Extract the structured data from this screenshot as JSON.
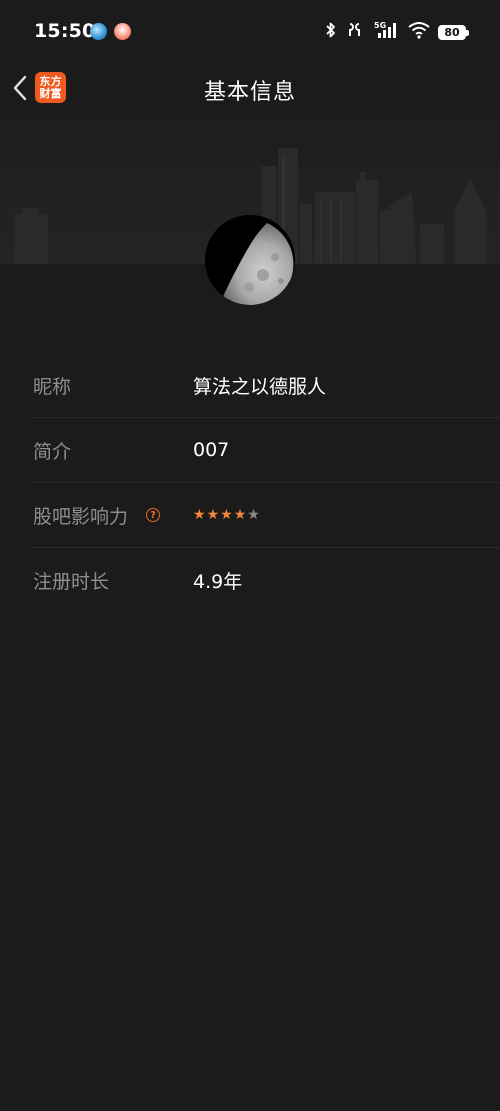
{
  "status_bar": {
    "time": "15:50",
    "battery": "80",
    "icons": [
      "app-notification-icon",
      "app-notification-icon",
      "bluetooth-icon",
      "earbuds-icon",
      "signal-5g-icon",
      "wifi-icon",
      "battery-icon"
    ]
  },
  "header": {
    "title": "基本信息",
    "brand_line1": "东方",
    "brand_line2": "财富"
  },
  "profile": {
    "rows": [
      {
        "label": "昵称",
        "value": "算法之以德服人"
      },
      {
        "label": "简介",
        "value": "007"
      },
      {
        "label": "股吧影响力",
        "help_icon": "?",
        "stars": 5,
        "filled_stars": 4
      },
      {
        "label": "注册时长",
        "value": "4.9年"
      }
    ]
  },
  "colors": {
    "background": "#1b1b1b",
    "accent": "#ee6a2a",
    "label": "#8e8e8e",
    "value": "#ffffff"
  }
}
